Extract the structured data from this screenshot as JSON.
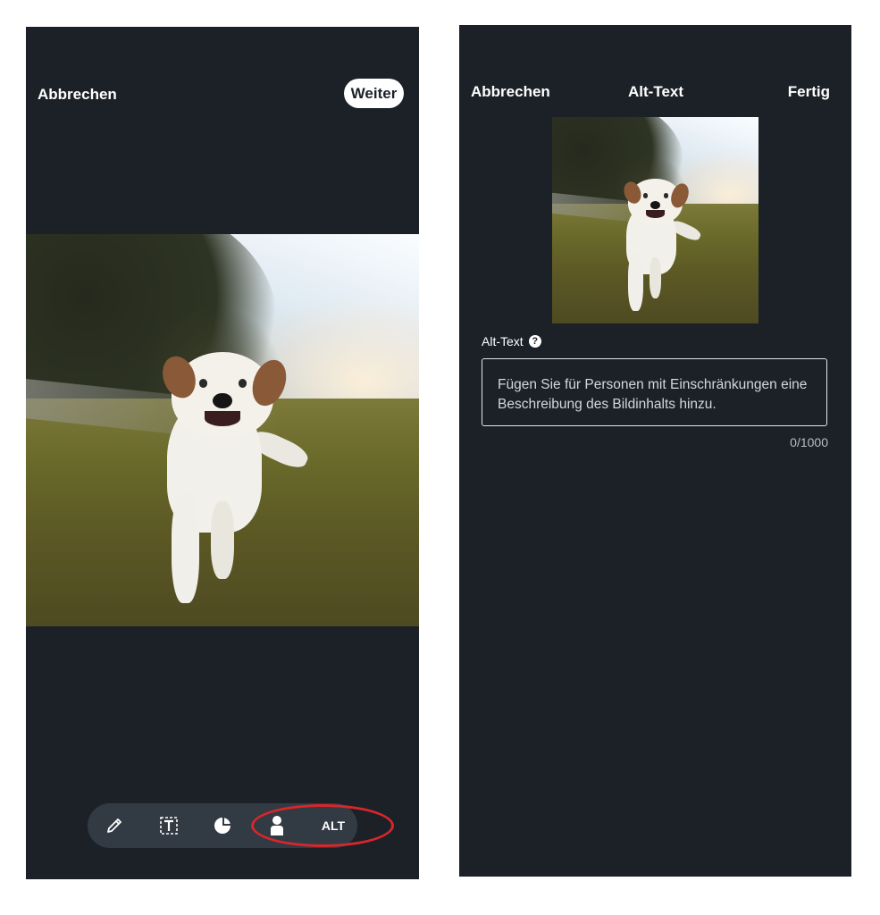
{
  "left_screen": {
    "header": {
      "cancel_label": "Abbrechen",
      "next_label": "Weiter"
    },
    "photo": {
      "subject": "dog running on grass"
    },
    "toolbar": {
      "tools": [
        {
          "name": "edit",
          "icon": "pencil-icon"
        },
        {
          "name": "text",
          "icon": "text-box-icon"
        },
        {
          "name": "sticker",
          "icon": "sticker-icon"
        },
        {
          "name": "person-tag",
          "icon": "person-icon"
        },
        {
          "name": "alt",
          "label": "ALT"
        }
      ],
      "highlight_color": "#d8262b"
    }
  },
  "right_screen": {
    "header": {
      "cancel_label": "Abbrechen",
      "title": "Alt-Text",
      "done_label": "Fertig"
    },
    "alt_text": {
      "label": "Alt-Text",
      "help_icon": "question-icon",
      "placeholder": "Fügen Sie für Personen mit Einschränkungen eine Beschreibung des Bildinhalts hinzu.",
      "counter": "0/1000"
    }
  },
  "colors": {
    "background": "#1c2127",
    "toolbar": "#323a44",
    "text": "#ffffff",
    "annotation": "#d8262b"
  }
}
